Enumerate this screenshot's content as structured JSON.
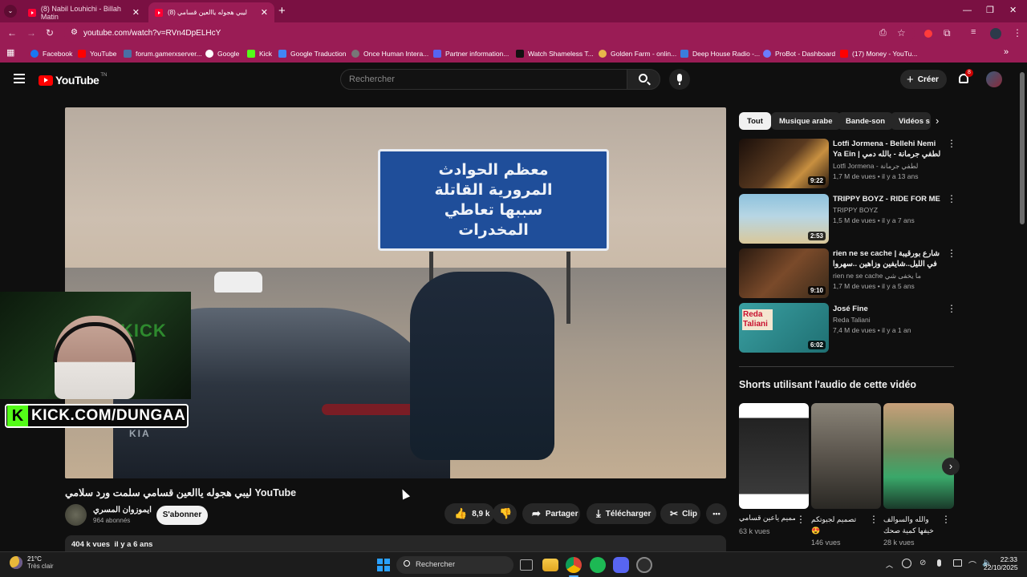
{
  "browser": {
    "tabs": [
      {
        "title": "(8) Nabil Louhichi - Billah Matin",
        "active": false
      },
      {
        "title": "(8) ليبي هجوله ياالعين قسامي",
        "active": true
      }
    ],
    "new_tab": "+",
    "url": "youtube.com/watch?v=RVn4DpELHcY",
    "bookmarks": [
      "Facebook",
      "YouTube",
      "forum.gamerxserver...",
      "Google",
      "Kick",
      "Google Traduction",
      "Once Human Intera...",
      "Partner information...",
      "Watch Shameless T...",
      "Golden Farm - onlin...",
      "Deep House Radio -...",
      "ProBot - Dashboard",
      "(17) Money - YouTu..."
    ]
  },
  "youtube": {
    "logo": "YouTube",
    "logo_sup": "TN",
    "search_placeholder": "Rechercher",
    "create_label": "Créer",
    "notif_count": "8",
    "video": {
      "title": "ليبي هجوله ياالعين قسامي سلمت ورد سلامي YouTube",
      "sign_lines": [
        "معظم الحوادث",
        "المرورية القاتلة",
        "سببها تعاطي",
        "المخدرات"
      ],
      "channel": "ايموزوان المسري",
      "subscribers": "964 abonnés",
      "subscribe_label": "S'abonner",
      "likes": "8,9 k",
      "share_label": "Partager",
      "download_label": "Télécharger",
      "clip_label": "Clip",
      "more": "•••",
      "views_date": "404 k vues  il y a 6 ans"
    },
    "overlay": {
      "kick_text": "KICK.COM/DUNGAA",
      "kick_badge": "KICK"
    },
    "chips": [
      "Tout",
      "Musique arabe",
      "Bande-son",
      "Vidéos s"
    ],
    "recommendations": [
      {
        "title": "Lotfi Jormena - Bellehi Nemi Ya Ein | لطفي جرمانة - بالله دمي يا عين",
        "channel": "Lotfi Jormena - لطفي جرمانة",
        "meta": "1,7 M de vues • il y a 13 ans",
        "duration": "9:22",
        "thumb_color": "#3a2a20"
      },
      {
        "title": "TRIPPY BOYZ - RIDE FOR ME",
        "channel": "TRIPPY BOYZ",
        "meta": "1,5 M de vues • il y a 7 ans",
        "duration": "2:53",
        "thumb_color": "#7fb3c9"
      },
      {
        "title": "rien ne se cache | شارع بورقيبة في الليل..شايفين وزاهين ..سهروا والفجر مرتاح",
        "channel": "rien ne se cache ما يخفى شي",
        "meta": "1,7 M de vues • il y a 5 ans",
        "duration": "9:10",
        "thumb_color": "#5a3a2a"
      },
      {
        "title": "José Fine",
        "channel": "Reda Taliani",
        "meta": "7,4 M de vues • il y a 1 an",
        "duration": "6:02",
        "thumb_color": "#2b8a8c",
        "thumb_text": "Reda Taliani"
      }
    ],
    "shorts_heading": "Shorts utilisant l'audio de cette vidéo",
    "shorts": [
      {
        "title": "تصميم ياعين قسامي",
        "views": "63 k vues",
        "color": "#222"
      },
      {
        "title": "تصميم لجيوتكم 😍",
        "views": "146 vues",
        "color": "#4a4640"
      },
      {
        "title": "والله والسوالف خيفها كمية صحك",
        "views": "28 k vues",
        "color": "#3d5c4a"
      }
    ]
  },
  "taskbar": {
    "weather_temp": "21°C",
    "weather_desc": "Très clair",
    "search_label": "Rechercher",
    "time": "22:33",
    "date": "22/10/2025"
  }
}
